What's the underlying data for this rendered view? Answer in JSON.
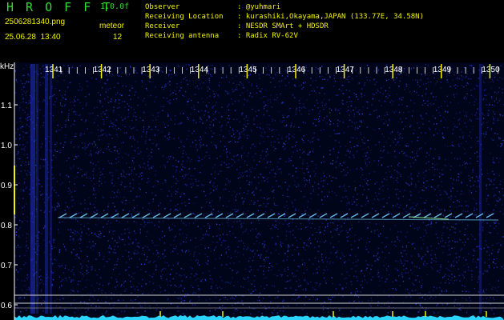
{
  "header": {
    "logo": "H R O F F T",
    "version": "1.0.0f",
    "file_name": "2506281340.png",
    "mode": "meteor",
    "datetime": "25.06.28  13:40",
    "count": "12"
  },
  "station_info": [
    {
      "label": "Observer",
      "value": ": @yuhmari"
    },
    {
      "label": "Receiving Location",
      "value": ": kurashiki,Okayama,JAPAN (133.77E, 34.58N)"
    },
    {
      "label": "Receiver",
      "value": ": NESDR SMArt + HDSDR"
    },
    {
      "label": "Receiving antenna",
      "value": ": Radix RV-62V"
    }
  ],
  "plot": {
    "y_unit": "kHz",
    "y_ticks": [
      "1.1",
      "1.0",
      "0.9",
      "0.8",
      "0.7",
      "0.6"
    ],
    "minute_ticks": [
      "1341",
      "1342",
      "1343",
      "1344",
      "1345",
      "1346",
      "1347",
      "1348",
      "1349",
      "1350"
    ]
  },
  "colors": {
    "header_green": "#2fdc2f",
    "header_yellow": "#f2f200",
    "tick_yellow": "#f2f200",
    "noise_blue": "#2233cc",
    "signal_cyan": "#7ad7ff",
    "baseline_cyan": "#29d4ff"
  }
}
